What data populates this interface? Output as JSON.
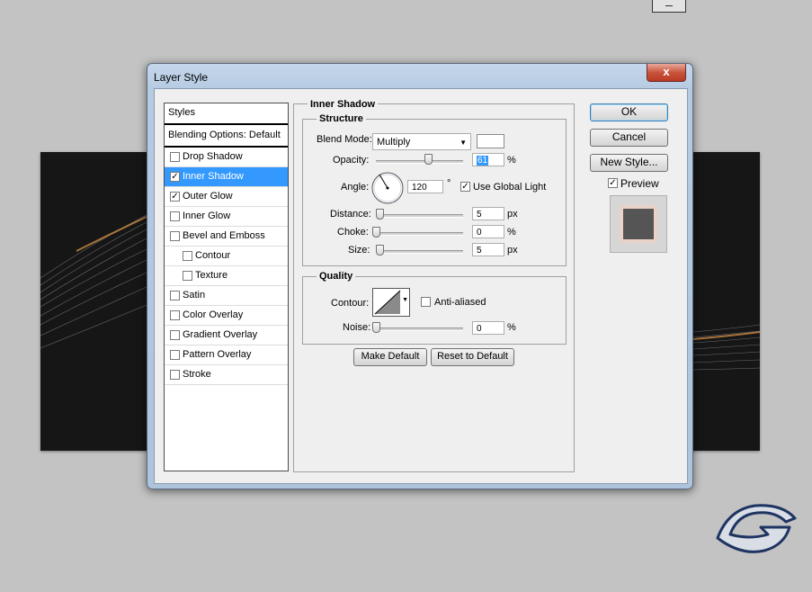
{
  "dialog": {
    "title": "Layer Style",
    "close_label": "x"
  },
  "styles_list": {
    "header": "Styles",
    "blending": "Blending Options: Default",
    "items": [
      {
        "label": "Drop Shadow",
        "checked": false,
        "selected": false,
        "indent": false
      },
      {
        "label": "Inner Shadow",
        "checked": true,
        "selected": true,
        "indent": false
      },
      {
        "label": "Outer Glow",
        "checked": true,
        "selected": false,
        "indent": false
      },
      {
        "label": "Inner Glow",
        "checked": false,
        "selected": false,
        "indent": false
      },
      {
        "label": "Bevel and Emboss",
        "checked": false,
        "selected": false,
        "indent": false
      },
      {
        "label": "Contour",
        "checked": false,
        "selected": false,
        "indent": true
      },
      {
        "label": "Texture",
        "checked": false,
        "selected": false,
        "indent": true
      },
      {
        "label": "Satin",
        "checked": false,
        "selected": false,
        "indent": false
      },
      {
        "label": "Color Overlay",
        "checked": false,
        "selected": false,
        "indent": false
      },
      {
        "label": "Gradient Overlay",
        "checked": false,
        "selected": false,
        "indent": false
      },
      {
        "label": "Pattern Overlay",
        "checked": false,
        "selected": false,
        "indent": false
      },
      {
        "label": "Stroke",
        "checked": false,
        "selected": false,
        "indent": false
      }
    ]
  },
  "panel": {
    "section_title": "Inner Shadow",
    "structure": {
      "title": "Structure",
      "blend_mode_label": "Blend Mode:",
      "blend_mode_value": "Multiply",
      "blend_color": "#ffffff",
      "opacity_label": "Opacity:",
      "opacity_value": "61",
      "opacity_unit": "%",
      "angle_label": "Angle:",
      "angle_value": "120",
      "angle_unit": "°",
      "global_light_label": "Use Global Light",
      "global_light_checked": true,
      "distance_label": "Distance:",
      "distance_value": "5",
      "distance_unit": "px",
      "choke_label": "Choke:",
      "choke_value": "0",
      "choke_unit": "%",
      "size_label": "Size:",
      "size_value": "5",
      "size_unit": "px"
    },
    "quality": {
      "title": "Quality",
      "contour_label": "Contour:",
      "anti_aliased_label": "Anti-aliased",
      "anti_aliased_checked": false,
      "noise_label": "Noise:",
      "noise_value": "0",
      "noise_unit": "%"
    },
    "make_default": "Make Default",
    "reset_default": "Reset to Default"
  },
  "buttons": {
    "ok": "OK",
    "cancel": "Cancel",
    "new_style": "New Style...",
    "preview_label": "Preview",
    "preview_checked": true
  },
  "colors": {
    "selection": "#3399ff",
    "canvas": "#161616",
    "page_bg": "#c3c3c3"
  }
}
